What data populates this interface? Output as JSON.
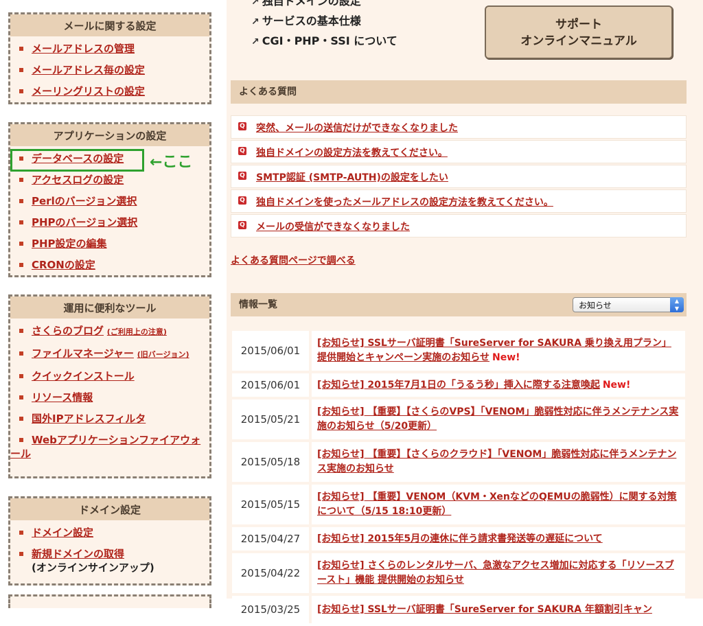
{
  "sidebar": {
    "mail": {
      "title": "メールに関する設定",
      "items": [
        "メールアドレスの管理",
        "メールアドレス毎の設定",
        "メーリングリストの設定"
      ]
    },
    "app": {
      "title": "アプリケーションの設定",
      "items": [
        "データベースの設定",
        "アクセスログの設定",
        "Perlのバージョン選択",
        "PHPのバージョン選択",
        "PHP設定の編集",
        "CRONの設定"
      ],
      "annotation": "←ここ"
    },
    "tools": {
      "title": "運用に便利なツール",
      "blog": "さくらのブログ",
      "blog_note": "(ご利用上の注意)",
      "filemanager": "ファイルマネージャー",
      "filemanager_note": "(旧バージョン)",
      "quickinstall": "クイックインストール",
      "resource": "リソース情報",
      "ipfilter": "国外IPアドレスフィルタ",
      "waf": "Webアプリケーションファイアウォール"
    },
    "domain": {
      "title": "ドメイン設定",
      "setting": "ドメイン設定",
      "new_domain": "新規ドメインの取得",
      "new_domain_note": "(オンラインサインアップ)"
    }
  },
  "main": {
    "top_links": [
      "独自ドメインの設定",
      "サービスの基本仕様",
      "CGI・PHP・SSI について"
    ],
    "support_button": [
      "サポート",
      "オンラインマニュアル"
    ],
    "faq": {
      "title": "よくある質問",
      "items": [
        "突然、メールの送信だけができなくなりました",
        "独自ドメインの設定方法を教えてください。",
        "SMTP認証 (SMTP-AUTH)の設定をしたい",
        "独自ドメインを使ったメールアドレスの設定方法を教えてください。",
        "メールの受信ができなくなりました"
      ],
      "more": "よくある質問ページで調べる"
    },
    "news": {
      "title": "情報一覧",
      "filter_value": "お知らせ",
      "new_label": "New!",
      "items": [
        {
          "date": "2015/06/01",
          "title": "[お知らせ] SSLサーバ証明書「SureServer for SAKURA 乗り換え用プラン」提供開始とキャンペーン実施のお知らせ",
          "new": true
        },
        {
          "date": "2015/06/01",
          "title": "[お知らせ] 2015年7月1日の「うるう秒」挿入に際する注意喚起",
          "new": true
        },
        {
          "date": "2015/05/21",
          "title": "[お知らせ] 【重要】【さくらのVPS】「VENOM」脆弱性対応に伴うメンテナンス実施のお知らせ（5/20更新）",
          "new": false
        },
        {
          "date": "2015/05/18",
          "title": "[お知らせ] 【重要】【さくらのクラウド】「VENOM」脆弱性対応に伴うメンテナンス実施のお知らせ",
          "new": false
        },
        {
          "date": "2015/05/15",
          "title": "[お知らせ] 【重要】VENOM（KVM・XenなどのQEMUの脆弱性）に関する対策について（5/15 18:10更新）",
          "new": false
        },
        {
          "date": "2015/04/27",
          "title": "[お知らせ] 2015年5月の連休に伴う請求書発送等の遅延について",
          "new": false
        },
        {
          "date": "2015/04/22",
          "title": "[お知らせ] さくらのレンタルサーバ、急激なアクセス増加に対応する「リソースブースト」機能 提供開始のお知らせ",
          "new": false
        },
        {
          "date": "2015/03/25",
          "title": "[お知らせ] SSLサーバ証明書「SureServer for SAKURA 年額割引キャン",
          "new": false
        }
      ]
    }
  }
}
